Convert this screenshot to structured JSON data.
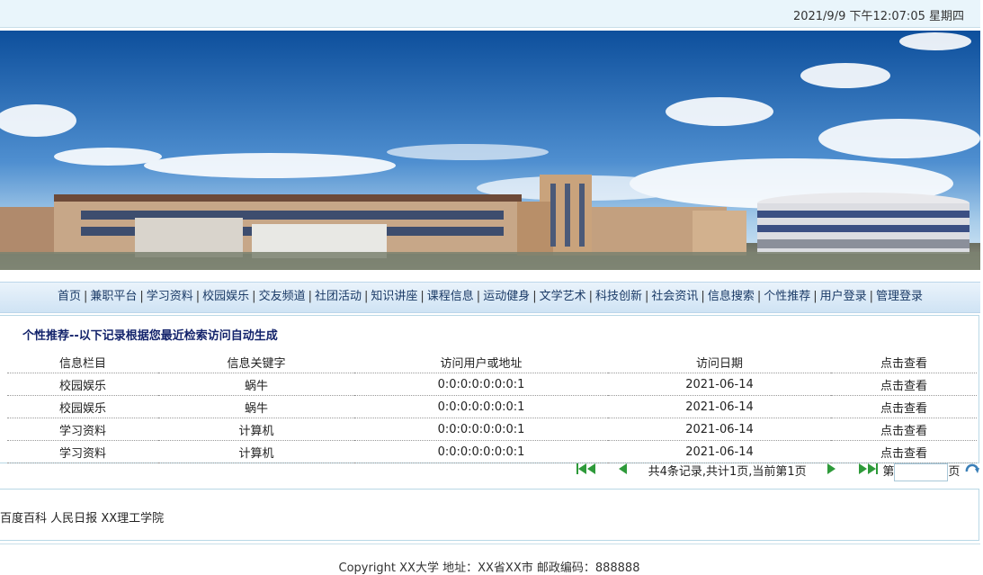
{
  "header": {
    "datetime": "2021/9/9 下午12:07:05  星期四"
  },
  "nav": {
    "items": [
      "首页",
      "兼职平台",
      "学习资料",
      "校园娱乐",
      "交友频道",
      "社团活动",
      "知识讲座",
      "课程信息",
      "运动健身",
      "文学艺术",
      "科技创新",
      "社会资讯",
      "信息搜索",
      "个性推荐",
      "用户登录",
      "管理登录"
    ],
    "separator": "|"
  },
  "panel": {
    "title": "个性推荐--以下记录根据您最近检索访问自动生成",
    "columns": [
      "信息栏目",
      "信息关键字",
      "访问用户或地址",
      "访问日期",
      "点击查看"
    ],
    "rows": [
      {
        "column": "校园娱乐",
        "keyword": "蜗牛",
        "user": "0:0:0:0:0:0:0:1",
        "date": "2021-06-14",
        "action": "点击查看"
      },
      {
        "column": "校园娱乐",
        "keyword": "蜗牛",
        "user": "0:0:0:0:0:0:0:1",
        "date": "2021-06-14",
        "action": "点击查看"
      },
      {
        "column": "学习资料",
        "keyword": "计算机",
        "user": "0:0:0:0:0:0:0:1",
        "date": "2021-06-14",
        "action": "点击查看"
      },
      {
        "column": "学习资料",
        "keyword": "计算机",
        "user": "0:0:0:0:0:0:0:1",
        "date": "2021-06-14",
        "action": "点击查看"
      }
    ]
  },
  "pager": {
    "summary": "共4条记录,共计1页,当前第1页",
    "goto_prefix": "第",
    "goto_suffix": "页",
    "page_value": ""
  },
  "links": [
    "百度百科",
    "人民日报",
    "XX理工学院"
  ],
  "footer": {
    "text": "Copyright XX大学 地址：XX省XX市 邮政编码：888888"
  },
  "colors": {
    "accent": "#13236b",
    "nav_text": "#1a3a66",
    "pager_icon": "#2e9a3a"
  }
}
